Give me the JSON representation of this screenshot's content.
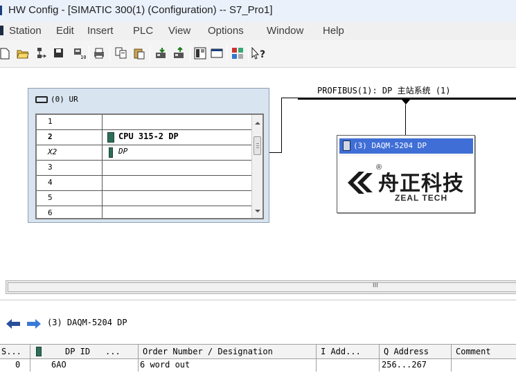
{
  "window": {
    "title": "HW Config - [SIMATIC 300(1) (Configuration) -- S7_Pro1]"
  },
  "menu": [
    "Station",
    "Edit",
    "Insert",
    "PLC",
    "View",
    "Options",
    "Window",
    "Help"
  ],
  "toolbar": {
    "icons": [
      "new-icon",
      "open-icon",
      "network-icon",
      "save-icon",
      "compile-icon",
      "print-icon",
      "copy-icon",
      "paste-icon",
      "download-icon",
      "upload-icon",
      "catalog-icon",
      "window-icon",
      "network-config-icon",
      "help-icon"
    ],
    "help_label": "?"
  },
  "rack": {
    "title": "(0) UR",
    "slots": [
      {
        "num": "1",
        "module": ""
      },
      {
        "num": "2",
        "module": "CPU 315-2 DP"
      },
      {
        "num": "X2",
        "module": "DP"
      },
      {
        "num": "3",
        "module": ""
      },
      {
        "num": "4",
        "module": ""
      },
      {
        "num": "5",
        "module": ""
      },
      {
        "num": "6",
        "module": ""
      }
    ]
  },
  "bus": {
    "label": "PROFIBUS(1): DP 主站系统 (1)"
  },
  "slave": {
    "header": "(3) DAQM-5204  DP",
    "logo_cn": "舟正科技",
    "logo_en": "ZEAL TECH",
    "logo_mark": "®"
  },
  "scrollbar": {
    "grip": "III"
  },
  "detail": {
    "title": "(3)   DAQM-5204  DP",
    "columns": [
      "S...",
      "DP ID",
      "...",
      "Order Number / Designation",
      "I Add...",
      "Q Address",
      "Comment"
    ],
    "rows": [
      {
        "slot": "0",
        "dp_id": "6AO",
        "designation": "6 word out",
        "i_addr": "",
        "q_addr": "256...267",
        "comment": ""
      }
    ]
  },
  "colors": {
    "selection": "#3f6ed6",
    "rack_bg": "#d8e4ef"
  }
}
